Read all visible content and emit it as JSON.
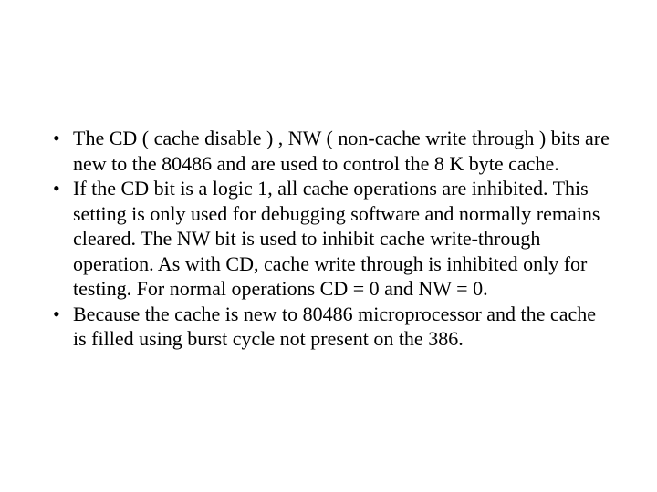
{
  "bullets": [
    "The CD ( cache disable ) , NW ( non-cache write through ) bits are new to the 80486  and are used to control the 8 K byte cache.",
    "If the CD bit is a logic 1, all cache operations are inhibited. This setting is only used for debugging software and normally remains cleared. The NW bit is used to inhibit cache write-through operation. As with CD, cache write through is inhibited only for testing. For normal operations CD = 0 and NW = 0.",
    "Because the cache is new to 80486 microprocessor and the cache is filled using burst cycle not present on the 386."
  ]
}
